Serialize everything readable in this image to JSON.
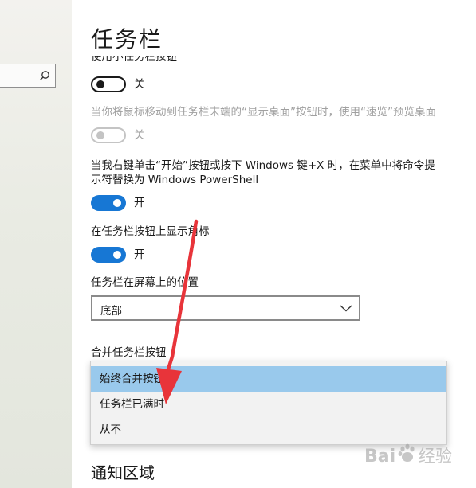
{
  "sidebar": {
    "search_icon": "search-icon"
  },
  "page": {
    "title": "任务栏"
  },
  "settings": {
    "small_buttons": {
      "label": "使用小任务栏按钮",
      "state": "关"
    },
    "peek": {
      "label": "当你将鼠标移动到任务栏末端的“显示桌面”按钮时，使用“速览”预览桌面",
      "state": "关"
    },
    "powershell": {
      "label_line1": "当我右键单击“开始”按钮或按下 Windows 键+X 时，在菜单中将命令提",
      "label_line2": "示符替换为 Windows PowerShell",
      "state": "开"
    },
    "badges": {
      "label": "在任务栏按钮上显示角标",
      "state": "开"
    },
    "location": {
      "label": "任务栏在屏幕上的位置",
      "value": "底部"
    },
    "combine": {
      "label": "合并任务栏按钮",
      "options": [
        "始终合并按钮",
        "任务栏已满时",
        "从不"
      ],
      "selected_index": 0
    }
  },
  "notification": {
    "title": "通知区域"
  },
  "colors": {
    "accent": "#1777d4",
    "selected": "#99c9ec",
    "arrow": "#e8343a"
  },
  "watermark": {
    "text": "Baidu 经验"
  }
}
